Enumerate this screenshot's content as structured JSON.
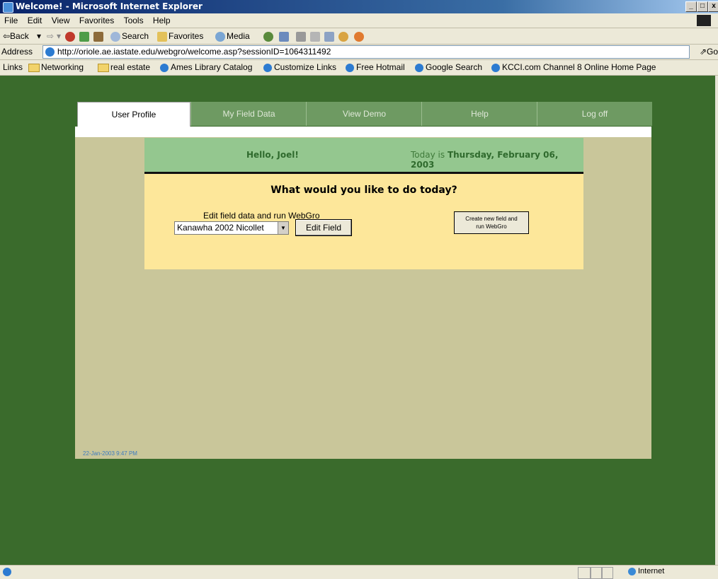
{
  "window": {
    "title": "Welcome! - Microsoft Internet Explorer",
    "controls": [
      "_",
      "□",
      "x"
    ]
  },
  "menu": [
    "File",
    "Edit",
    "View",
    "Favorites",
    "Tools",
    "Help"
  ],
  "toolbar": {
    "back": "⇦Back",
    "back_arrow": "▾",
    "forward": "⇨",
    "forward_arrow": "▾",
    "search": "Search",
    "favorites": "Favorites",
    "media": "Media"
  },
  "address": {
    "label": "Address",
    "url": "http://oriole.ae.iastate.edu/webgro/welcome.asp?sessionID=1064311492",
    "go": "⇗Go"
  },
  "links": {
    "label": "Links",
    "items": [
      {
        "label": "Networking",
        "icon": "folder-icon"
      },
      {
        "label": "real estate",
        "icon": "folder-icon"
      },
      {
        "label": "Ames Library Catalog",
        "icon": "ie-page-icon"
      },
      {
        "label": "Customize Links",
        "icon": "ie-page-icon"
      },
      {
        "label": "Free Hotmail",
        "icon": "ie-page-icon"
      },
      {
        "label": "Google Search",
        "icon": "ie-page-icon"
      },
      {
        "label": "KCCI.com Channel 8 Online Home Page",
        "icon": "ie-page-icon"
      }
    ]
  },
  "tabs": [
    {
      "label": "User Profile",
      "active": true
    },
    {
      "label": "My Field Data",
      "active": false
    },
    {
      "label": "View Demo",
      "active": false
    },
    {
      "label": "Help",
      "active": false
    },
    {
      "label": "Log off",
      "active": false
    }
  ],
  "greeting": {
    "hello": "Hello, Joel!",
    "today_prefix": "Today is",
    "today_date": "Thursday, February 06, 2003"
  },
  "main": {
    "question": "What would you like to do today?",
    "edit_label": "Edit field data and run WebGro",
    "field_select": "Kanawha 2002 Nicollet",
    "edit_button": "Edit Field",
    "create_button_line1": "Create new field and",
    "create_button_line2": "run WebGro"
  },
  "timestamp": "22-Jan-2003 9:47 PM",
  "status": {
    "zone": "Internet"
  },
  "colors": {
    "background": "#3a6b2c",
    "page": "#c9c69a",
    "card": "#fde79a",
    "card_header": "#94c78f",
    "tab": "#6e9a62"
  }
}
